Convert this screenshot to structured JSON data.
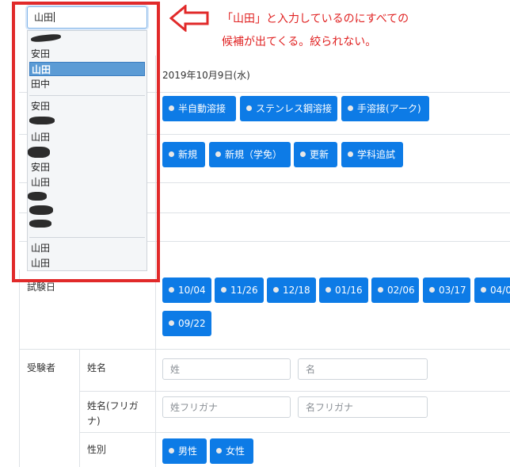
{
  "annotation": {
    "line1": "「山田」と入力しているのにすべての",
    "line2": "候補が出てくる。絞られない。",
    "color": "#e02222"
  },
  "search": {
    "value": "山田"
  },
  "dropdown": {
    "opt1": "安田",
    "opt2": "山田",
    "opt3": "田中",
    "opt4": "安田",
    "opt5": "山田",
    "opt6": "安田",
    "opt7": "山田",
    "opt8": "山田",
    "opt9": "山田"
  },
  "form": {
    "date_value": "2019年10月9日(水)",
    "welding": [
      "半自動溶接",
      "ステンレス鋼溶接",
      "手溶接(アーク)"
    ],
    "application": [
      "新規",
      "新規（学免）",
      "更新",
      "学科追試"
    ],
    "exam_date_label": "試験日",
    "exam_dates": [
      "10/04",
      "11/26",
      "12/18",
      "01/16",
      "02/06",
      "03/17",
      "04/0",
      "09/22"
    ],
    "examinee_label": "受験者",
    "name_label": "姓名",
    "last_name_placeholder": "姓",
    "first_name_placeholder": "名",
    "kana_label_1": "姓名(フリガ",
    "kana_label_2": "ナ)",
    "last_kana_placeholder": "姓フリガナ",
    "first_kana_placeholder": "名フリガナ",
    "gender_label": "性別",
    "genders": [
      "男性",
      "女性"
    ]
  },
  "colors": {
    "primary": "#0d7be6",
    "highlight": "#5b9bd5",
    "annotation_red": "#e12a2a"
  }
}
